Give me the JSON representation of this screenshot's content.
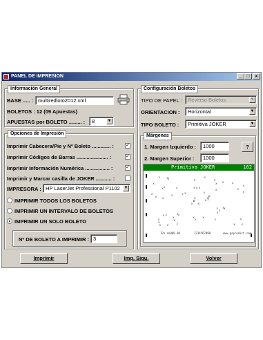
{
  "window": {
    "title": "PANEL DE IMPRESION",
    "min": "_",
    "max": "□",
    "close": "x"
  },
  "general": {
    "title": "Información General",
    "base_label": "BASE ..... :",
    "base_value": "multiredloto2012.xml",
    "boletos_label": "BOLETOS : 12 (09 Apuestas)",
    "apuestas_label": "APUESTAS por BOLETO ......... :",
    "apuestas_value": "8"
  },
  "opciones": {
    "title": "Opciones de Impresión",
    "checks": [
      {
        "label": "Imprimir Cabecera/Pie y Nº Boleto ............. :",
        "checked": "✓"
      },
      {
        "label": "Imprimir Códigos de Barras ...................... :",
        "checked": "✓"
      },
      {
        "label": "Imprimir Información Numérica ................. :",
        "checked": "✓"
      },
      {
        "label": "Imprimir y Marcar casilla de JOKER ........... :",
        "checked": ""
      }
    ],
    "impresora_label": "IMPRESORA :",
    "impresora_value": "HP LaserJet Professional P1102",
    "radios": [
      {
        "label": "IMPRIMIR TODOS LOS BOLETOS",
        "selected": false
      },
      {
        "label": "IMPRIMIR UN INTERVALO DE BOLETOS",
        "selected": false
      },
      {
        "label": "IMPRIMIR UN SOLO BOLETO",
        "selected": true
      }
    ],
    "boleto_label": "Nº DE BOLETO A IMPRIMIR :",
    "boleto_value": "3"
  },
  "config": {
    "title": "Configuración Boletos",
    "tipo_papel_label": "TIPO DE PAPEL :",
    "tipo_papel_value": "Reverso Boletos",
    "orientacion_label": "ORIENTACION :",
    "orientacion_value": "Horizontal",
    "tipo_boleto_label": "TIPO BOLETO :",
    "tipo_boleto_value": "Primitiva JOKER"
  },
  "margenes": {
    "title": "Márgenes",
    "izq_label": "1. Margen Izquierdo :",
    "izq_value": "1000",
    "sup_label": "2. Margen Superior :",
    "sup_value": "1000",
    "help": "?"
  },
  "preview": {
    "title": "Primitiva JOKER",
    "number": "162",
    "footer_left": "12n nn000 00",
    "footer_mid": "1234567890",
    "footer_right": "www.gspredict.com"
  },
  "buttons": {
    "imprimir": "Imprimir",
    "imp_sigu": "Imp. Sigu.",
    "volver": "Volver"
  }
}
